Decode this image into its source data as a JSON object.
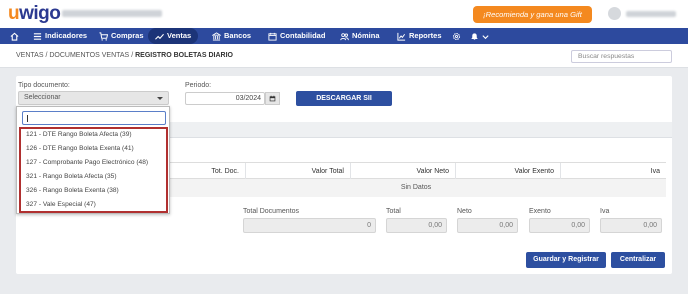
{
  "topbar": {
    "logo_letter": "u",
    "logo_rest": "wigo",
    "gift_label": "¡Recomienda y gana una Gift Card!"
  },
  "nav": {
    "items": [
      {
        "label": "Indicadores",
        "icon": "list-icon"
      },
      {
        "label": "Compras",
        "icon": "cart-icon"
      },
      {
        "label": "Ventas",
        "icon": "trend-icon"
      },
      {
        "label": "Bancos",
        "icon": "bank-icon"
      },
      {
        "label": "Contabilidad",
        "icon": "calendar-icon"
      },
      {
        "label": "Nómina",
        "icon": "people-icon"
      },
      {
        "label": "Reportes",
        "icon": "chart-icon"
      }
    ],
    "active": "Ventas"
  },
  "breadcrumb": {
    "part1": "VENTAS",
    "part2": "DOCUMENTOS VENTAS",
    "current": "REGISTRO BOLETAS DIARIO",
    "sep": "/"
  },
  "search": {
    "placeholder": "Buscar respuestas"
  },
  "form": {
    "tipo_label": "Tipo documento:",
    "tipo_value": "Seleccionar",
    "periodo_label": "Periodo:",
    "periodo_value": "03/2024",
    "download_label": "DESCARGAR SII"
  },
  "dropdown": {
    "options": [
      "121 - DTE Rango Boleta Afecta (39)",
      "126 - DTE Rango Boleta Exenta (41)",
      "127 - Comprobante Pago Electrónico (48)",
      "321 - Rango Boleta Afecta (35)",
      "326 - Rango Boleta Exenta (38)",
      "327 - Vale Especial (47)"
    ]
  },
  "table": {
    "headers": [
      "Tot. Doc.",
      "Valor Total",
      "Valor Neto",
      "Valor Exento",
      "Iva"
    ],
    "empty_text": "Sin Datos"
  },
  "totals": {
    "labels": [
      "Total Documentos",
      "Total",
      "Neto",
      "Exento",
      "Iva"
    ],
    "values": [
      "0",
      "0,00",
      "0,00",
      "0,00",
      "0,00"
    ]
  },
  "actions": {
    "save_label": "Guardar y Registrar",
    "centralize_label": "Centralizar"
  },
  "colors": {
    "brand": "#2d4a9e",
    "accent": "#f4891f",
    "highlight": "#b03030"
  }
}
